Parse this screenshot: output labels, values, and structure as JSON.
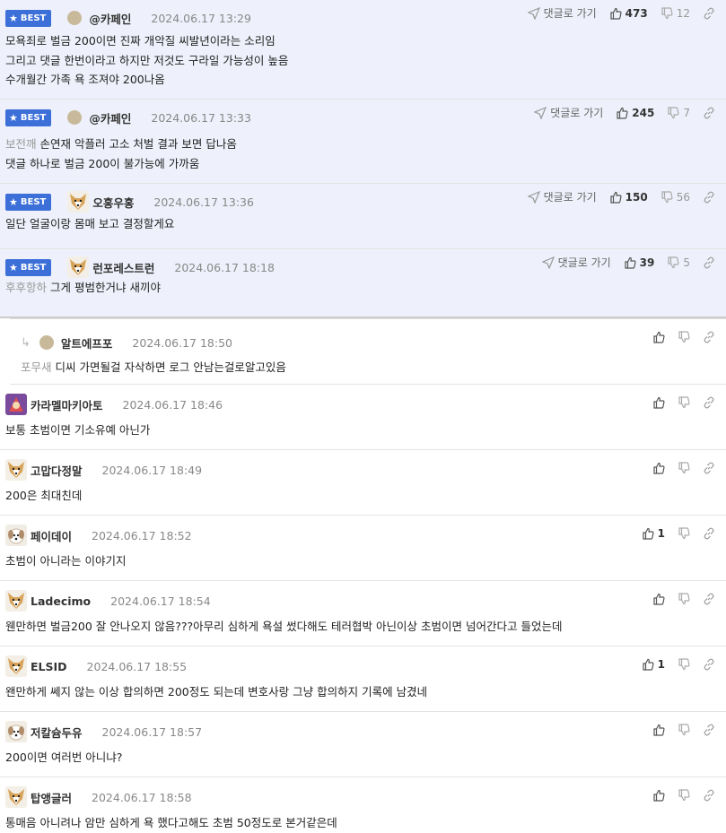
{
  "best_badge": "BEST",
  "reply_link_label": "댓글로 가기",
  "comments": [
    {
      "nick": "@카페인",
      "date": "2024.06.17 13:29",
      "up": "473",
      "down": "12",
      "lines": [
        "모욕죄로 벌금 200이면 진짜 개악질 씨발년이라는 소리임",
        "그리고 댓글 한번이라고 하지만 저것도 구라일 가능성이 높음",
        "수개월간 가족 욕 조져야 200나옴"
      ]
    },
    {
      "nick": "@카페인",
      "date": "2024.06.17 13:33",
      "up": "245",
      "down": "7",
      "mention": "보전깨",
      "lines": [
        "손연재 악플러 고소 처벌 결과 보면 답나옴",
        "댓글 하나로 벌금 200이 불가능에 가까움"
      ]
    },
    {
      "nick": "오홍우홍",
      "date": "2024.06.17 13:36",
      "up": "150",
      "down": "56",
      "lines": [
        "일단 얼굴이랑 몸매 보고 결정할게요"
      ]
    },
    {
      "nick": "런포레스트런",
      "date": "2024.06.17 18:18",
      "up": "39",
      "down": "5",
      "mention": "후후항하",
      "lines": [
        "그게 평범한거냐 새끼야"
      ]
    },
    {
      "nick": "알트에프포",
      "date": "2024.06.17 18:50",
      "mention": "포무새",
      "lines": [
        "디씨 가면될걸 자삭하면 로그 안남는걸로알고있음"
      ]
    },
    {
      "nick": "카라멜마키아토",
      "date": "2024.06.17 18:46",
      "lines": [
        "보통 초범이면 기소유예 아닌가"
      ]
    },
    {
      "nick": "고맙다정말",
      "date": "2024.06.17 18:49",
      "lines": [
        "200은 최대친데"
      ]
    },
    {
      "nick": "페이데이",
      "date": "2024.06.17 18:52",
      "up": "1",
      "lines": [
        "초범이 아니라는 이야기지"
      ]
    },
    {
      "nick": "Ladecimo",
      "date": "2024.06.17 18:54",
      "lines": [
        "웬만하면 벌금200 잘 안나오지 않음???아무리 심하게 욕설 썼다해도 테러협박 아닌이상 초범이면 넘어간다고 들었는데"
      ]
    },
    {
      "nick": "ELSID",
      "date": "2024.06.17 18:55",
      "up": "1",
      "lines": [
        "왠만하게 쎄지 않는 이상 합의하면 200정도 되는데 변호사랑 그냥 합의하지 기록에 남겼네"
      ]
    },
    {
      "nick": "저칼슘두유",
      "date": "2024.06.17 18:57",
      "lines": [
        "200이면 여러번 아니냐?"
      ]
    },
    {
      "nick": "탑앵글러",
      "date": "2024.06.17 18:58",
      "lines": [
        "통매음 아니려나 암만 심하게 욕 했다고해도 초범 50정도로 본거같은데"
      ]
    }
  ]
}
